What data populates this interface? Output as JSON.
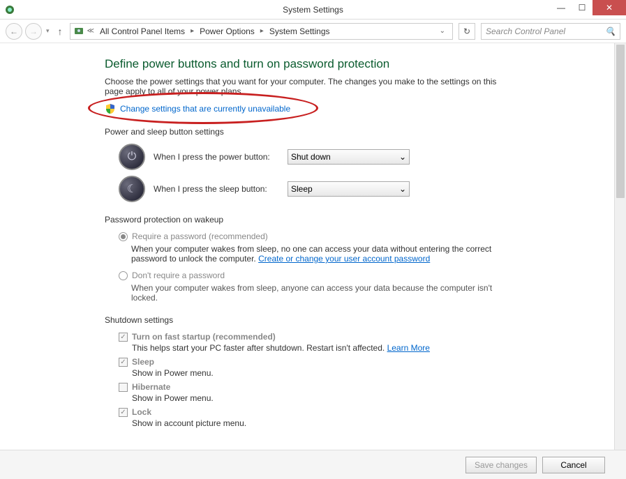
{
  "window": {
    "title": "System Settings"
  },
  "breadcrumb": {
    "items": [
      "All Control Panel Items",
      "Power Options",
      "System Settings"
    ]
  },
  "search": {
    "placeholder": "Search Control Panel"
  },
  "main": {
    "heading": "Define power buttons and turn on password protection",
    "intro": "Choose the power settings that you want for your computer. The changes you make to the settings on this page apply to all of your power plans.",
    "change_link": "Change settings that are currently unavailable"
  },
  "power_sleep": {
    "section": "Power and sleep button settings",
    "power_label": "When I press the power button:",
    "power_value": "Shut down",
    "sleep_label": "When I press the sleep button:",
    "sleep_value": "Sleep"
  },
  "password": {
    "section": "Password protection on wakeup",
    "opt1_label": "Require a password (recommended)",
    "opt1_desc_a": "When your computer wakes from sleep, no one can access your data without entering the correct password to unlock the computer. ",
    "opt1_link": "Create or change your user account password",
    "opt2_label": "Don't require a password",
    "opt2_desc": "When your computer wakes from sleep, anyone can access your data because the computer isn't locked."
  },
  "shutdown": {
    "section": "Shutdown settings",
    "items": [
      {
        "label": "Turn on fast startup (recommended)",
        "checked": true,
        "desc": "This helps start your PC faster after shutdown. Restart isn't affected. ",
        "link": "Learn More"
      },
      {
        "label": "Sleep",
        "checked": true,
        "desc": "Show in Power menu."
      },
      {
        "label": "Hibernate",
        "checked": false,
        "desc": "Show in Power menu."
      },
      {
        "label": "Lock",
        "checked": true,
        "desc": "Show in account picture menu."
      }
    ]
  },
  "footer": {
    "save": "Save changes",
    "cancel": "Cancel"
  }
}
